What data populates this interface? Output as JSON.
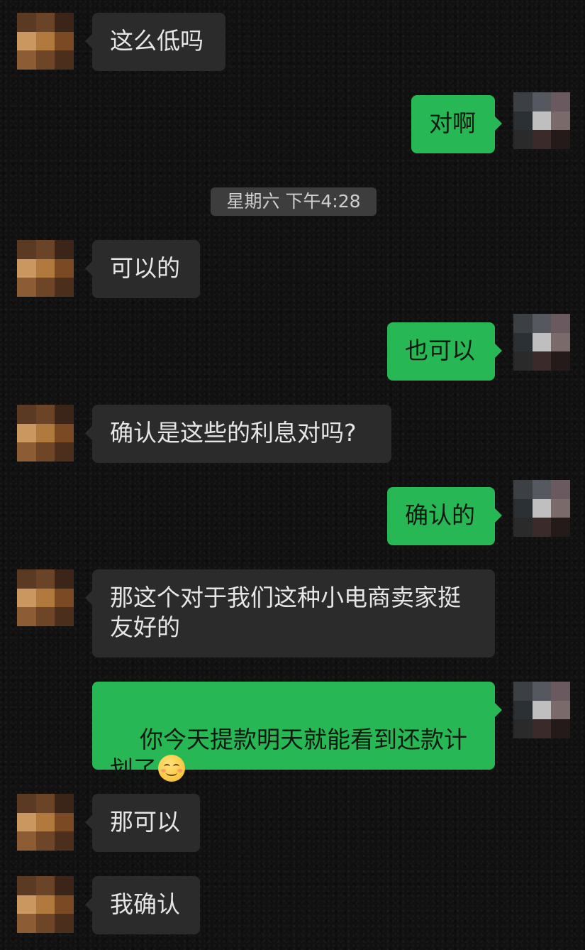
{
  "timestamp": "星期六 下午4:28",
  "messages": [
    {
      "side": "in",
      "text": "这么低吗"
    },
    {
      "side": "out",
      "text": "对啊"
    },
    {
      "side": "in",
      "text": "可以的"
    },
    {
      "side": "out",
      "text": "也可以"
    },
    {
      "side": "in",
      "text": "确认是这些的利息对吗?"
    },
    {
      "side": "out",
      "text": "确认的"
    },
    {
      "side": "in",
      "text": "那这个对于我们这种小电商卖家挺友好的"
    },
    {
      "side": "out",
      "text": "你今天提款明天就能看到还款计划了",
      "emoji": "smiling-face-emoji"
    },
    {
      "side": "in",
      "text": "那可以"
    },
    {
      "side": "in",
      "text": "我确认"
    }
  ],
  "colors": {
    "background": "#111111",
    "incoming_bubble": "#2b2b2b",
    "outgoing_bubble": "#27b855",
    "timestamp_bg": "#3d3d3d"
  }
}
